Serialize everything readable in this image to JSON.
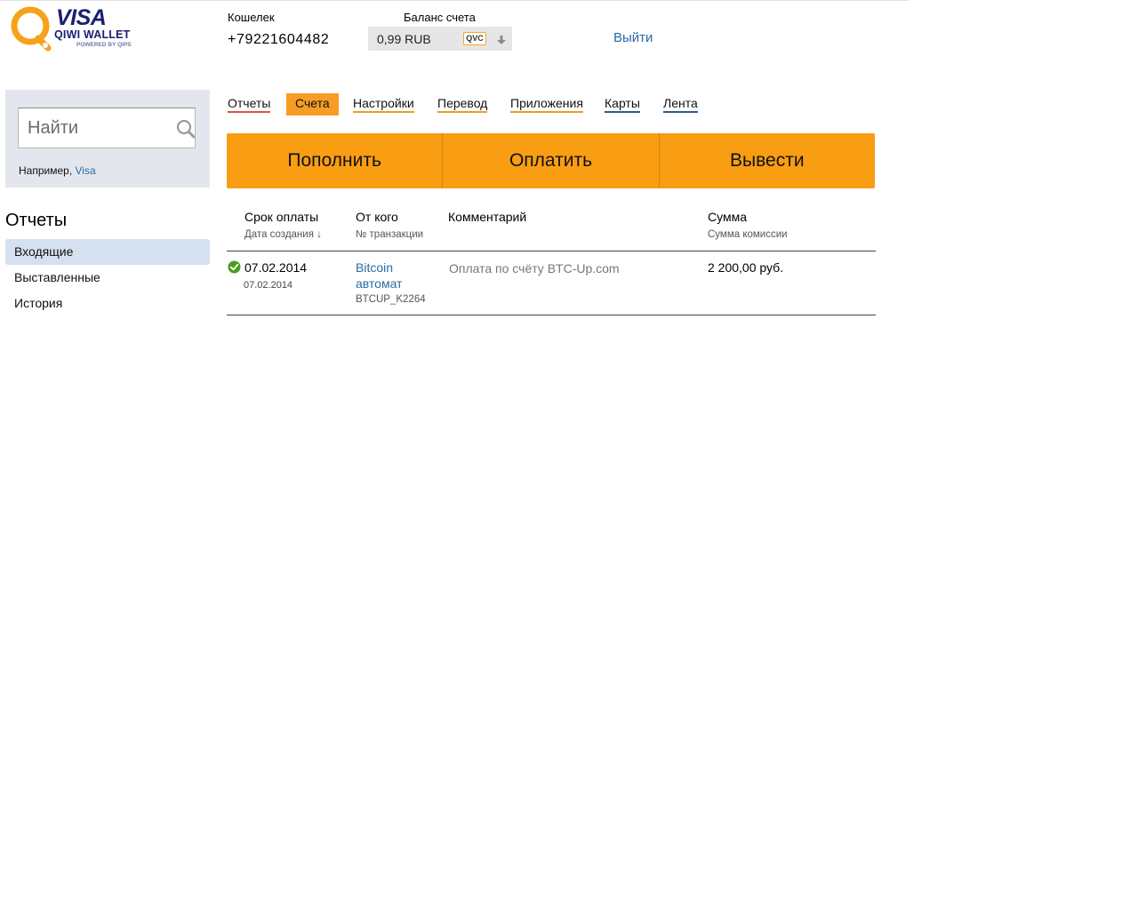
{
  "logo": {
    "brand": "VISA",
    "product": "QIWI WALLET",
    "powered": "POWERED BY QIPS",
    "accent": "#f7a21b"
  },
  "header": {
    "wallet_label": "Кошелек",
    "wallet_number": "+79221604482",
    "balance_label": "Баланс счета",
    "balance_value": "0,99 RUB",
    "currency_badge": "QVC",
    "logout": "Выйти"
  },
  "search": {
    "placeholder": "Найти",
    "hint_prefix": "Например,",
    "hint_example": "Visa"
  },
  "sidebar": {
    "title": "Отчеты",
    "items": [
      {
        "label": "Входящие",
        "active": true
      },
      {
        "label": "Выставленные",
        "active": false
      },
      {
        "label": "История",
        "active": false
      }
    ]
  },
  "tabs": [
    {
      "label": "Отчеты",
      "underline": "#d9534f"
    },
    {
      "label": "Счета",
      "active": true
    },
    {
      "label": "Настройки",
      "underline": "#e3a025"
    },
    {
      "label": "Перевод",
      "underline": "#e3a025"
    },
    {
      "label": "Приложения",
      "underline": "#e3a025"
    },
    {
      "label": "Карты",
      "underline": "#2c5d8f"
    },
    {
      "label": "Лента",
      "underline": "#2c5d8f"
    }
  ],
  "actions": {
    "topup": "Пополнить",
    "pay": "Оплатить",
    "withdraw": "Вывести",
    "color": "#f99d12"
  },
  "table": {
    "headers": {
      "due": "Срок оплаты",
      "created": "Дата создания ↓",
      "from": "От кого",
      "transaction": "№ транзакции",
      "comment": "Комментарий",
      "amount": "Сумма",
      "fee": "Сумма комиссии"
    },
    "rows": [
      {
        "status": "paid",
        "due": "07.02.2014",
        "created": "07.02.2014",
        "from": "Bitcoin автомат",
        "transaction": "BTCUP_K2264",
        "comment": "Оплата по счёту BTC-Up.com",
        "amount": "2 200,00 руб."
      }
    ]
  }
}
